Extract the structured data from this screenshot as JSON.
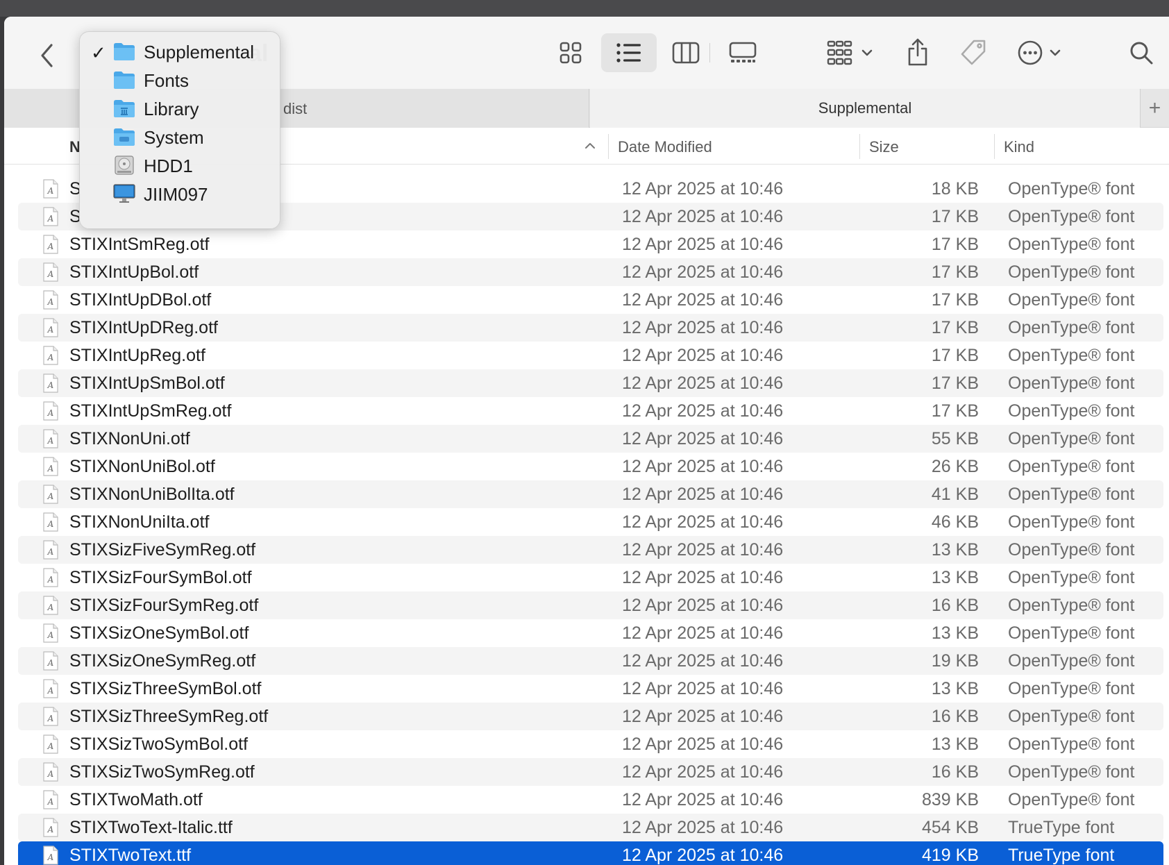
{
  "toolbar": {
    "title_fragment": "al",
    "back_icon": "chevron-left-icon",
    "view_buttons": [
      "icon-view-icon",
      "list-view-icon",
      "column-view-icon",
      "gallery-view-icon"
    ],
    "active_view": "list",
    "group_icon": "group-by-icon",
    "share_icon": "share-icon",
    "tag_icon": "tag-icon",
    "more_icon": "ellipsis-circle-icon",
    "search_icon": "search-icon"
  },
  "tabs": {
    "inactive_label": "dist",
    "active_label": "Supplemental",
    "add_label": "+"
  },
  "columns": {
    "name": "N",
    "date": "Date Modified",
    "size": "Size",
    "kind": "Kind",
    "sort_indicator": "^"
  },
  "path_menu": {
    "items": [
      {
        "label": "Supplemental",
        "checked": true,
        "icon": "folder-icon"
      },
      {
        "label": "Fonts",
        "checked": false,
        "icon": "folder-icon"
      },
      {
        "label": "Library",
        "checked": false,
        "icon": "library-folder-icon"
      },
      {
        "label": "System",
        "checked": false,
        "icon": "system-folder-icon"
      },
      {
        "label": "HDD1",
        "checked": false,
        "icon": "hard-drive-icon"
      },
      {
        "label": "JIIM097",
        "checked": false,
        "icon": "computer-icon"
      }
    ],
    "check_mark": "✓"
  },
  "files": [
    {
      "name": "S",
      "date": "12 Apr 2025 at 10:46",
      "size": "18 KB",
      "kind": "OpenType® font"
    },
    {
      "name": "S",
      "date": "12 Apr 2025 at 10:46",
      "size": "17 KB",
      "kind": "OpenType® font"
    },
    {
      "name": "STIXIntSmReg.otf",
      "date": "12 Apr 2025 at 10:46",
      "size": "17 KB",
      "kind": "OpenType® font"
    },
    {
      "name": "STIXIntUpBol.otf",
      "date": "12 Apr 2025 at 10:46",
      "size": "17 KB",
      "kind": "OpenType® font"
    },
    {
      "name": "STIXIntUpDBol.otf",
      "date": "12 Apr 2025 at 10:46",
      "size": "17 KB",
      "kind": "OpenType® font"
    },
    {
      "name": "STIXIntUpDReg.otf",
      "date": "12 Apr 2025 at 10:46",
      "size": "17 KB",
      "kind": "OpenType® font"
    },
    {
      "name": "STIXIntUpReg.otf",
      "date": "12 Apr 2025 at 10:46",
      "size": "17 KB",
      "kind": "OpenType® font"
    },
    {
      "name": "STIXIntUpSmBol.otf",
      "date": "12 Apr 2025 at 10:46",
      "size": "17 KB",
      "kind": "OpenType® font"
    },
    {
      "name": "STIXIntUpSmReg.otf",
      "date": "12 Apr 2025 at 10:46",
      "size": "17 KB",
      "kind": "OpenType® font"
    },
    {
      "name": "STIXNonUni.otf",
      "date": "12 Apr 2025 at 10:46",
      "size": "55 KB",
      "kind": "OpenType® font"
    },
    {
      "name": "STIXNonUniBol.otf",
      "date": "12 Apr 2025 at 10:46",
      "size": "26 KB",
      "kind": "OpenType® font"
    },
    {
      "name": "STIXNonUniBolIta.otf",
      "date": "12 Apr 2025 at 10:46",
      "size": "41 KB",
      "kind": "OpenType® font"
    },
    {
      "name": "STIXNonUniIta.otf",
      "date": "12 Apr 2025 at 10:46",
      "size": "46 KB",
      "kind": "OpenType® font"
    },
    {
      "name": "STIXSizFiveSymReg.otf",
      "date": "12 Apr 2025 at 10:46",
      "size": "13 KB",
      "kind": "OpenType® font"
    },
    {
      "name": "STIXSizFourSymBol.otf",
      "date": "12 Apr 2025 at 10:46",
      "size": "13 KB",
      "kind": "OpenType® font"
    },
    {
      "name": "STIXSizFourSymReg.otf",
      "date": "12 Apr 2025 at 10:46",
      "size": "16 KB",
      "kind": "OpenType® font"
    },
    {
      "name": "STIXSizOneSymBol.otf",
      "date": "12 Apr 2025 at 10:46",
      "size": "13 KB",
      "kind": "OpenType® font"
    },
    {
      "name": "STIXSizOneSymReg.otf",
      "date": "12 Apr 2025 at 10:46",
      "size": "19 KB",
      "kind": "OpenType® font"
    },
    {
      "name": "STIXSizThreeSymBol.otf",
      "date": "12 Apr 2025 at 10:46",
      "size": "13 KB",
      "kind": "OpenType® font"
    },
    {
      "name": "STIXSizThreeSymReg.otf",
      "date": "12 Apr 2025 at 10:46",
      "size": "16 KB",
      "kind": "OpenType® font"
    },
    {
      "name": "STIXSizTwoSymBol.otf",
      "date": "12 Apr 2025 at 10:46",
      "size": "13 KB",
      "kind": "OpenType® font"
    },
    {
      "name": "STIXSizTwoSymReg.otf",
      "date": "12 Apr 2025 at 10:46",
      "size": "16 KB",
      "kind": "OpenType® font"
    },
    {
      "name": "STIXTwoMath.otf",
      "date": "12 Apr 2025 at 10:46",
      "size": "839 KB",
      "kind": "OpenType® font"
    },
    {
      "name": "STIXTwoText-Italic.ttf",
      "date": "12 Apr 2025 at 10:46",
      "size": "454 KB",
      "kind": "TrueType font"
    },
    {
      "name": "STIXTwoText.ttf",
      "date": "12 Apr 2025 at 10:46",
      "size": "419 KB",
      "kind": "TrueType font",
      "selected": true
    }
  ],
  "colors": {
    "selection": "#0a5fd6",
    "folder": "#5eb8f0",
    "alt_row": "#f4f4f4"
  }
}
